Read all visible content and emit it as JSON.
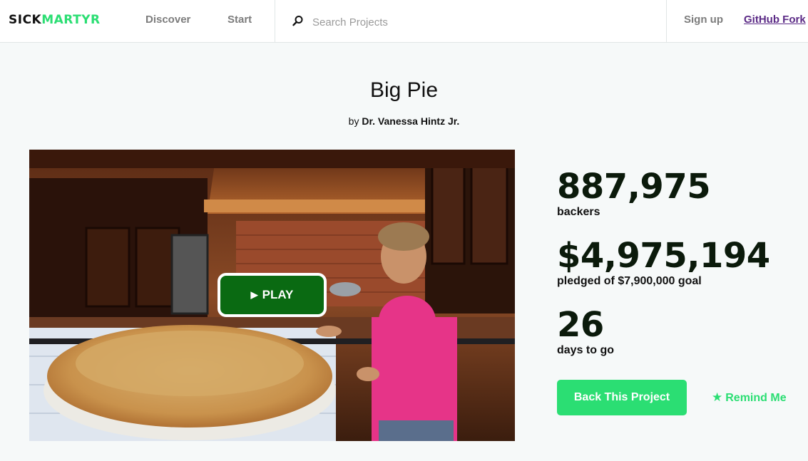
{
  "header": {
    "logo_part1": "SICK",
    "logo_part2": "MARTYR",
    "nav": {
      "discover": "Discover",
      "start": "Start"
    },
    "search": {
      "placeholder": "Search Projects",
      "value": ""
    },
    "signup": "Sign up",
    "github": "GitHub Fork"
  },
  "project": {
    "title": "Big Pie",
    "by_prefix": "by",
    "creator": "Dr. Vanessa Hintz Jr.",
    "play_label": "PLAY",
    "play_icon": "play-triangle"
  },
  "stats": {
    "backers": "887,975",
    "backers_label": "backers",
    "pledged": "$4,975,194",
    "pledged_label": "pledged of $7,900,000 goal",
    "days": "26",
    "days_label": "days to go"
  },
  "actions": {
    "back": "Back This Project",
    "remind": "Remind Me",
    "remind_icon": "star-icon"
  },
  "colors": {
    "brand_green": "#2bde73",
    "play_green": "#0a6a12",
    "github_link": "#5b2a86",
    "page_bg": "#f6f9f9"
  }
}
